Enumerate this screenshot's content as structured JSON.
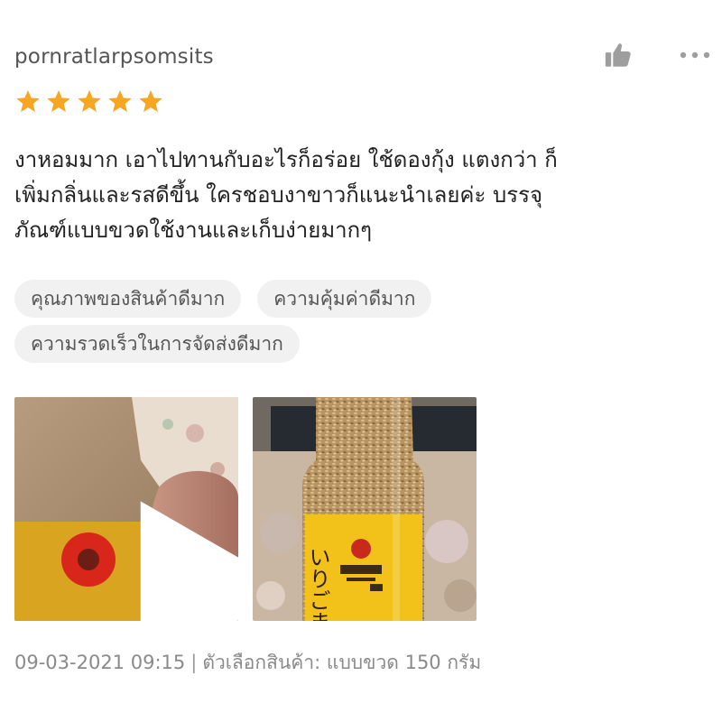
{
  "review": {
    "username": "pornratlarpsomsits",
    "rating": 5,
    "text_lines": [
      "งาหอมมาก เอาไปทานกับอะไรก็อร่อย ใช้ดองกุ้ง แตงกว่า ก็",
      "เพิ่มกลิ่นและรสดีขึ้น ใครชอบงาขาวก็แนะนำเลยค่ะ บรรจุ",
      "ภัณฑ์แบบขวดใช้งานและเก็บง่ายมากๆ"
    ],
    "tags": [
      "คุณภาพของสินค้าดีมาก",
      "ความคุ้มค่าดีมาก",
      "ความรวดเร็วในการจัดส่งดีมาก"
    ],
    "bottle_label_text": "いりごま",
    "datetime": "09-03-2021 09:15",
    "separator": "|",
    "variation_label": "ตัวเลือกสินค้า:",
    "variation_value": "แบบขวด 150 กรัม"
  },
  "icons": {
    "like": "thumbs-up-icon",
    "more": "more-dots-icon",
    "star": "star-icon",
    "play": "play-icon"
  },
  "colors": {
    "star": "#F6A623",
    "text": "#222222",
    "muted": "#8a8a8a",
    "tag_bg": "#f1f1f1",
    "icon_grey": "#9e9e9e"
  }
}
